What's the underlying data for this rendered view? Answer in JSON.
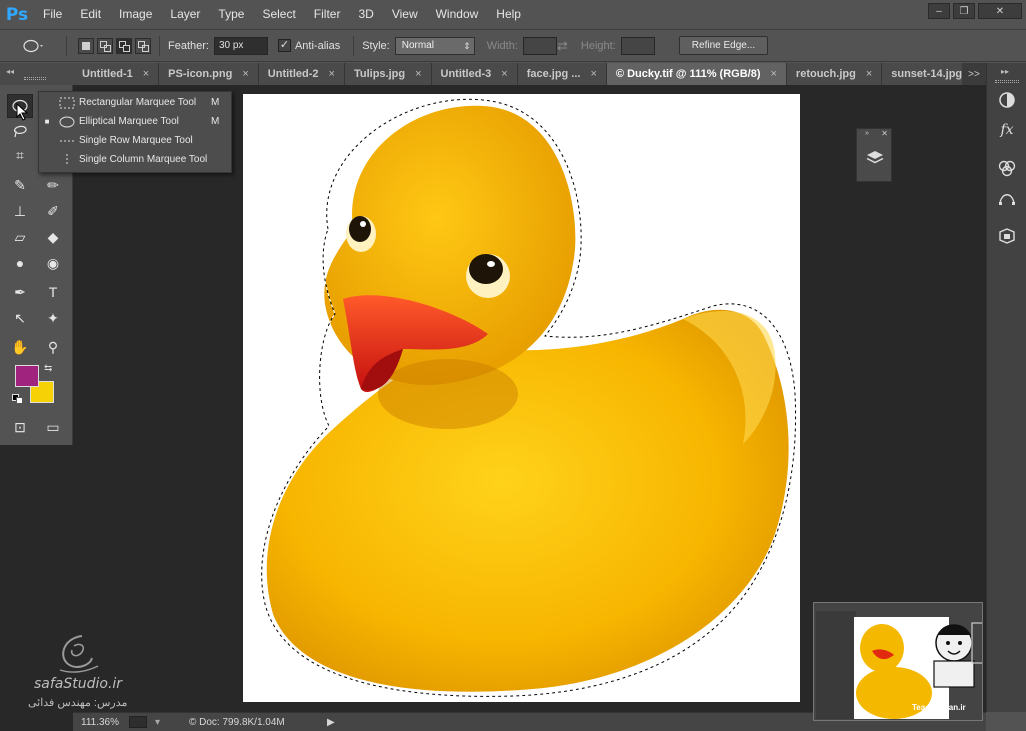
{
  "app": {
    "logo": "Ps"
  },
  "menu": [
    "File",
    "Edit",
    "Image",
    "Layer",
    "Type",
    "Select",
    "Filter",
    "3D",
    "View",
    "Window",
    "Help"
  ],
  "window_controls": {
    "minimize": "–",
    "restore": "❐",
    "close": "✕"
  },
  "options": {
    "feather_label": "Feather:",
    "feather_value": "30 px",
    "antialias_label": "Anti-alias",
    "antialias_checked": "✓",
    "style_label": "Style:",
    "style_value": "Normal",
    "width_label": "Width:",
    "height_label": "Height:",
    "refine_edge": "Refine Edge..."
  },
  "tabs": [
    {
      "label": "Untitled-1",
      "close": "×"
    },
    {
      "label": "PS-icon.png",
      "close": "×"
    },
    {
      "label": "Untitled-2",
      "close": "×"
    },
    {
      "label": "Tulips.jpg",
      "close": "×"
    },
    {
      "label": "Untitled-3",
      "close": "×"
    },
    {
      "label": "face.jpg ...",
      "close": "×"
    },
    {
      "label": "© Ducky.tif @ 111% (RGB/8)",
      "close": "×"
    },
    {
      "label": "retouch.jpg",
      "close": "×"
    },
    {
      "label": "sunset-14.jpg",
      "close": ""
    }
  ],
  "tab_overflow": ">>",
  "flyout": [
    {
      "label": "Rectangular Marquee Tool",
      "key": "M",
      "selected": ""
    },
    {
      "label": "Elliptical Marquee Tool",
      "key": "M",
      "selected": "■"
    },
    {
      "label": "Single Row Marquee Tool",
      "key": "",
      "selected": ""
    },
    {
      "label": "Single Column Marquee Tool",
      "key": "",
      "selected": ""
    }
  ],
  "tools": {
    "crop": "⌗",
    "heal": "✎",
    "brush": "✏",
    "stamp": "⊥",
    "history_brush": "✐",
    "eraser": "▱",
    "bucket": "◆",
    "blur": "●",
    "dodge": "◉",
    "pen": "✒",
    "type": "T",
    "path_select": "↖",
    "shape": "✦",
    "hand": "✋",
    "zoom": "⚲",
    "quickmask": "⊡",
    "screenmode": "▭"
  },
  "colors": {
    "foreground": "#a0237e",
    "background": "#f5d105"
  },
  "status": {
    "zoom": "111.36%",
    "doc": "© Doc: 799.8K/1.04M",
    "arrow": "▶"
  },
  "watermark": {
    "site": "safaStudio.ir",
    "teacher": "مدرس: مهندس فدائی"
  },
  "thumbnail": {
    "label": "TeacherMan.ir"
  },
  "right_panel": {
    "collapse": "»",
    "close": "✕"
  }
}
